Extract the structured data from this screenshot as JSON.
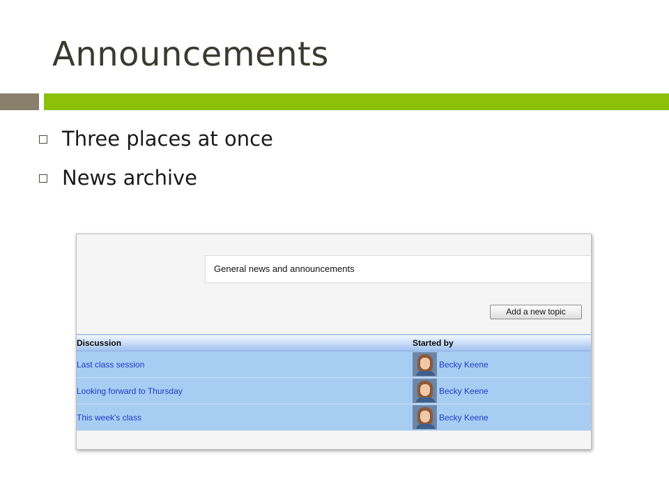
{
  "slide": {
    "title": "Announcements",
    "bullets": [
      "Three places at once",
      "News archive"
    ],
    "colors": {
      "accent": "#8cc10a",
      "rule_left": "#8a7f6d"
    }
  },
  "forum": {
    "description": "General news and announcements",
    "add_topic_label": "Add a new topic",
    "columns": {
      "discussion": "Discussion",
      "started_by": "Started by"
    },
    "rows": [
      {
        "topic": "Last class session",
        "author": "Becky Keene"
      },
      {
        "topic": "Looking forward to Thursday",
        "author": "Becky Keene"
      },
      {
        "topic": "This week's class",
        "author": "Becky Keene"
      }
    ],
    "colors": {
      "row_bg": "#a8cdf2",
      "link": "#1a3cc8"
    }
  }
}
